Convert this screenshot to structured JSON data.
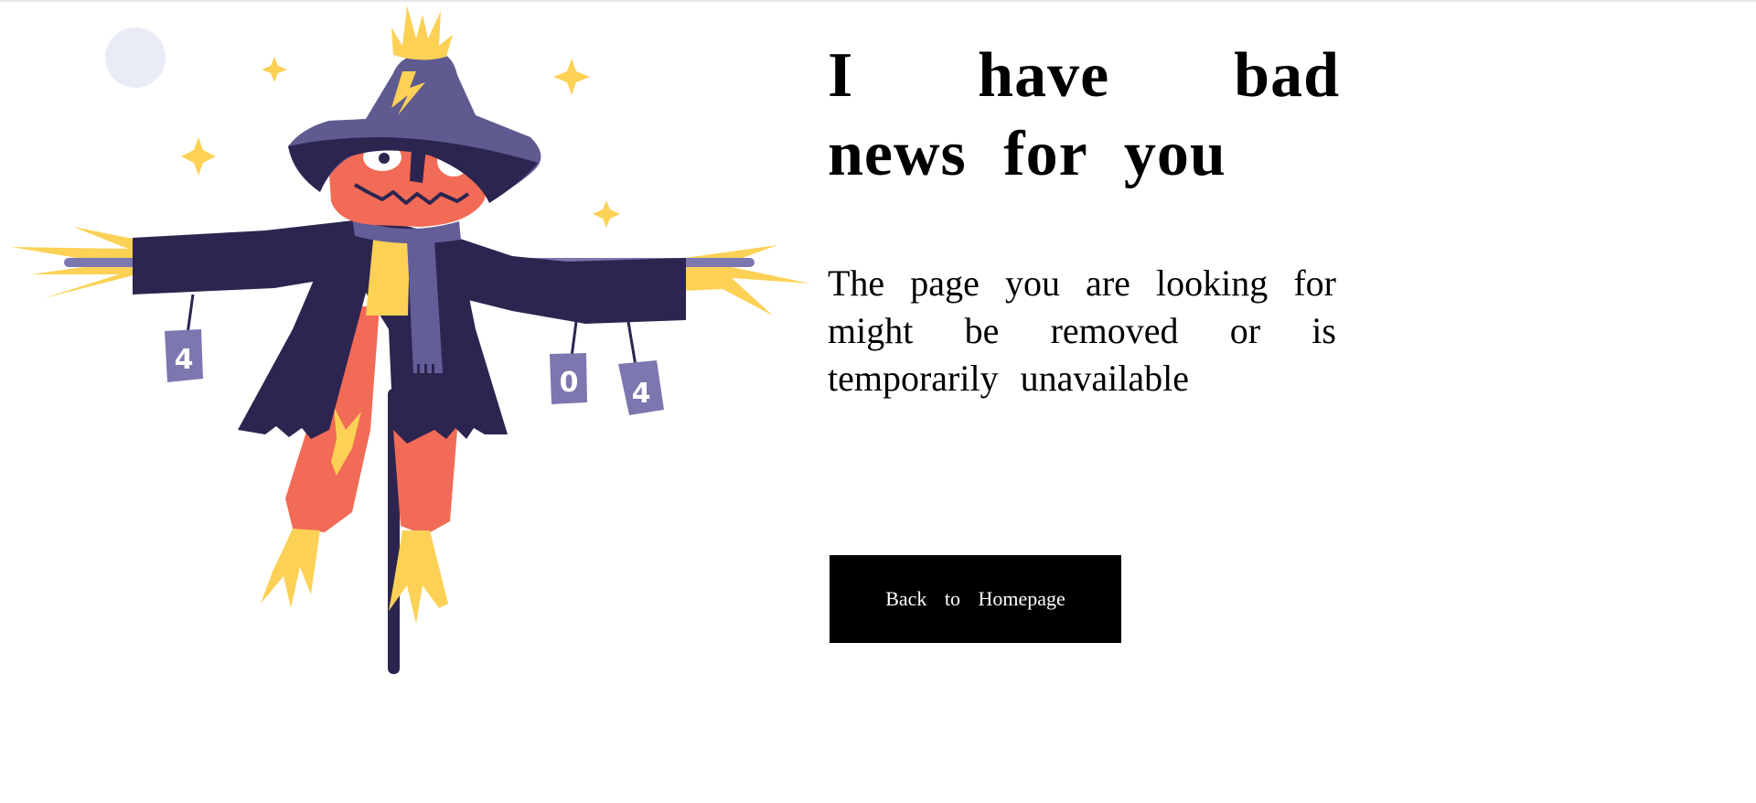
{
  "headline": "I have bad news for you",
  "message": "The page you are looking for might be removed or is temporarily unavailable",
  "back_button_label": "Back to Homepage",
  "illustration": {
    "can_labels": [
      "4",
      "0",
      "4"
    ],
    "colors": {
      "coat": "#2c2550",
      "hat": "#5f5a90",
      "scarf": "#635e98",
      "head": "#f26b57",
      "straw": "#fcd155",
      "can": "#7d77b0",
      "moon": "#e9ecf6"
    }
  }
}
